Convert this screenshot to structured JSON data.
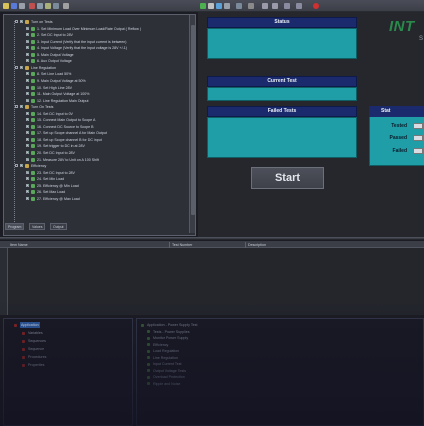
{
  "window": {
    "title": ""
  },
  "toolbar": {
    "icons": [
      "open-icon",
      "save-icon",
      "print-icon",
      "cut-icon",
      "copy-icon",
      "paste-icon",
      "find-icon",
      "run-icon",
      "pause-icon",
      "step-icon",
      "stop-icon",
      "settings-icon"
    ]
  },
  "tree": {
    "items": [
      {
        "num": "",
        "label": "Turn on Tests"
      },
      {
        "num": "1",
        "label": "Set Minimum Load Over Minimum Load/Rate Output  (  Reflow  )"
      },
      {
        "num": "2",
        "label": "Set DC Input to 28V"
      },
      {
        "num": "3",
        "label": "Input Current (Verify that the input current is between)"
      },
      {
        "num": "4",
        "label": "Input Voltage (Verify that the input voltage is 28V +/-1)"
      },
      {
        "num": "5",
        "label": "Main Output Voltage"
      },
      {
        "num": "6",
        "label": "Aux Output Voltage"
      },
      {
        "num": "",
        "label": "Line Regulation"
      },
      {
        "num": "8",
        "label": "Set Line Load 50%"
      },
      {
        "num": "9",
        "label": "Main Output Voltage at 50%"
      },
      {
        "num": "10",
        "label": "Set High Line 28V"
      },
      {
        "num": "11",
        "label": "Main Output Voltage at 100%"
      },
      {
        "num": "12",
        "label": "Line Regulation Main Output"
      },
      {
        "num": "",
        "label": "Turn On Tests"
      },
      {
        "num": "14",
        "label": "Set DC Input to 0V"
      },
      {
        "num": "15",
        "label": "Connect Main Output to Scope A"
      },
      {
        "num": "16",
        "label": "Connect DC Source to Scope B"
      },
      {
        "num": "17",
        "label": "Set up Scope channel A for Main Output"
      },
      {
        "num": "18",
        "label": "Set up Scope channel B for DC input"
      },
      {
        "num": "19",
        "label": "Set trigger to DC in at 28V"
      },
      {
        "num": "20",
        "label": "Set DC Input to 28V"
      },
      {
        "num": "21",
        "label": "Measure 28V to Unit on A 100 Shift"
      },
      {
        "num": "",
        "label": "Efficiency"
      },
      {
        "num": "23",
        "label": "Set DC Input to 28V"
      },
      {
        "num": "24",
        "label": "Set Min Load"
      },
      {
        "num": "25",
        "label": "Efficiency @ Min Load"
      },
      {
        "num": "26",
        "label": "Set Max Load"
      },
      {
        "num": "27",
        "label": "Efficiency @ Max Load"
      }
    ]
  },
  "left_tabs": [
    {
      "label": "Program"
    },
    {
      "label": "Values"
    },
    {
      "label": "Output"
    }
  ],
  "status": {
    "title": "Status",
    "value": ""
  },
  "current_test": {
    "title": "Current Test",
    "value": ""
  },
  "failed_tests": {
    "title": "Failed Tests",
    "value": ""
  },
  "start_button": {
    "label": "Start"
  },
  "logo": {
    "text": "INT",
    "subtext": "S"
  },
  "stats": {
    "title": "Stat",
    "tested_label": "Tested",
    "passed_label": "Passed",
    "failed_label": "Failed",
    "tested_value": "",
    "passed_value": "",
    "failed_value": ""
  },
  "results": {
    "columns": [
      "Item Name",
      "Test Number",
      "Description"
    ]
  },
  "bottom_left": {
    "items": [
      {
        "label": "Application"
      },
      {
        "label": "Variables"
      },
      {
        "label": "Sequences"
      },
      {
        "label": "Sequence"
      },
      {
        "label": "Procedures"
      },
      {
        "label": "Properties"
      }
    ]
  },
  "bottom_right": {
    "items": [
      {
        "label": "Application - Power Supply Test"
      },
      {
        "label": "Tests - Power Supplies"
      },
      {
        "label": "Monitor Power Supply"
      },
      {
        "label": "Efficiency"
      },
      {
        "label": "Load Regulation"
      },
      {
        "label": "Line Regulation"
      },
      {
        "label": "Input Current Test"
      },
      {
        "label": "Output Voltage Tests"
      },
      {
        "label": "Overload Protection"
      },
      {
        "label": "Ripple and Noise"
      }
    ]
  },
  "colors": {
    "accent": "#1a2a6c",
    "teal": "#1f9ea8",
    "logo_green": "#2a8a4c"
  }
}
